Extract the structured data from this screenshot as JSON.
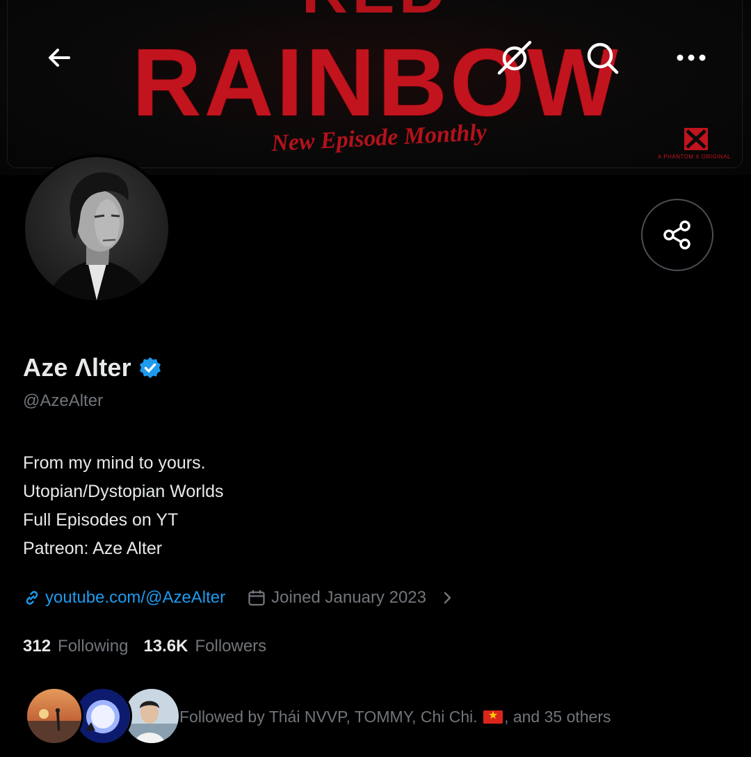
{
  "banner": {
    "title_top": "RED",
    "title": "RAINBOW",
    "subtitle": "New Episode Monthly",
    "brand": "A PHANTOM X ORIGINAL",
    "accent": "#c1141e"
  },
  "icons": {
    "back": "arrow-left-icon",
    "grok": "grok-icon",
    "search": "search-icon",
    "more": "more-horizontal-icon",
    "share": "share-icon",
    "verified": "verified-badge-icon",
    "link": "link-icon",
    "calendar": "calendar-icon",
    "chevron": "chevron-right-icon"
  },
  "profile": {
    "name": "Aze Λlter",
    "handle": "@AzeAlter",
    "bio": [
      "From my mind to yours.",
      "Utopian/Dystopian Worlds",
      "Full Episodes on YT",
      "Patreon: Aze Alter"
    ],
    "link": "youtube.com/@AzeAlter",
    "joined": "Joined January 2023"
  },
  "stats": {
    "following_count": "312",
    "following_label": "Following",
    "followers_count": "13.6K",
    "followers_label": "Followers"
  },
  "followed_by": {
    "prefix": "Followed by Thái NVVP, TOMMY, Chi Chi.",
    "suffix": ", and 35 others"
  },
  "colors": {
    "background": "#000000",
    "text": "#e7e9ea",
    "muted": "#71767b",
    "link": "#1d9bf0",
    "verified": "#1d9bf0"
  }
}
